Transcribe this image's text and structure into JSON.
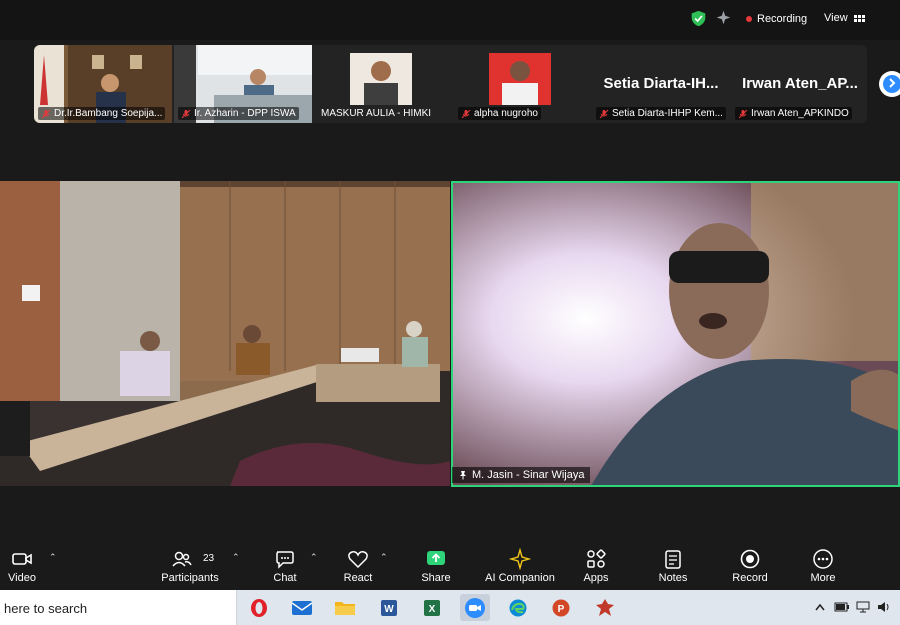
{
  "topbar": {
    "recording_label": "Recording",
    "view_label": "View",
    "colors": {
      "shield": "#2fbf56",
      "record_dot": "#e5393c"
    }
  },
  "participant_strip": {
    "tiles": [
      {
        "name": "Dr.Ir.Bambang Soepija..."
      },
      {
        "name": "Ir. Azharin - DPP ISWA"
      },
      {
        "name": "MASKUR AULIA - HIMKI"
      },
      {
        "name": "alpha nugroho"
      },
      {
        "name": "Setia Diarta-IHHP Kem...",
        "display_name": "Setia Diarta-IH..."
      },
      {
        "name": "Irwan Aten_APKINDO",
        "display_name": "Irwan Aten_AP..."
      }
    ]
  },
  "active_speaker": {
    "name": "M. Jasin - Sinar Wijaya",
    "border_color": "#2fd47a"
  },
  "toolbar": {
    "video": "Video",
    "participants": "Participants",
    "participants_count": "23",
    "chat": "Chat",
    "react": "React",
    "share": "Share",
    "ai_companion": "AI Companion",
    "apps": "Apps",
    "notes": "Notes",
    "record": "Record",
    "more": "More",
    "share_color": "#2fd47a"
  },
  "taskbar": {
    "search_placeholder": "here to search",
    "apps": [
      "opera",
      "mail",
      "file-explorer",
      "word",
      "excel",
      "zoom",
      "edge",
      "powerpoint",
      "app"
    ]
  }
}
